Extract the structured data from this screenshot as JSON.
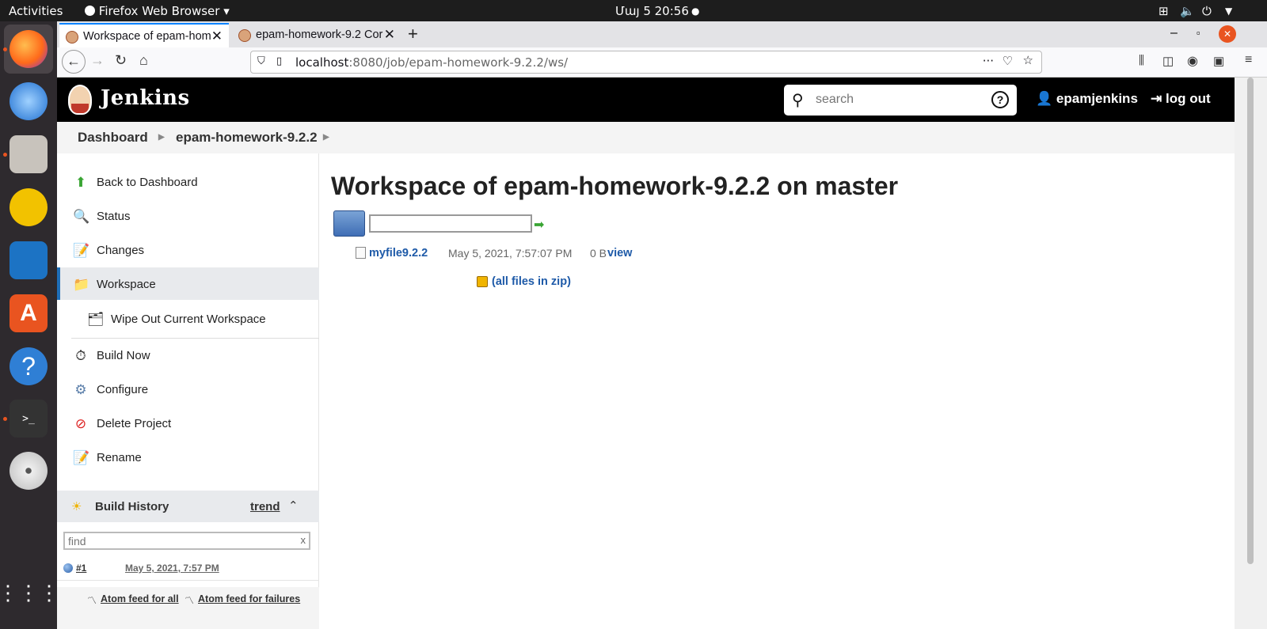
{
  "os": {
    "activities": "Activities",
    "app_menu": "Firefox Web Browser",
    "clock": "Մայ 5  20:56"
  },
  "browser": {
    "tabs": [
      {
        "label": "Workspace of epam-hom"
      },
      {
        "label": "epam-homework-9.2 Cor"
      }
    ],
    "url_host": "localhost",
    "url_rest": ":8080/job/epam-homework-9.2.2/ws/"
  },
  "jenkins": {
    "title": "Jenkins",
    "search_placeholder": "search",
    "user": "epamjenkins",
    "logout": "log out"
  },
  "breadcrumbs": [
    "Dashboard",
    "epam-homework-9.2.2"
  ],
  "sidebar": {
    "items": [
      {
        "label": "Back to Dashboard",
        "icon": "arrow-up-icon"
      },
      {
        "label": "Status",
        "icon": "magnifier-icon"
      },
      {
        "label": "Changes",
        "icon": "notepad-icon"
      },
      {
        "label": "Workspace",
        "icon": "folder-icon"
      },
      {
        "label": "Wipe Out Current Workspace",
        "icon": "folder-delete-icon"
      },
      {
        "label": "Build Now",
        "icon": "clock-icon"
      },
      {
        "label": "Configure",
        "icon": "gear-icon"
      },
      {
        "label": "Delete Project",
        "icon": "no-entry-icon"
      },
      {
        "label": "Rename",
        "icon": "notepad-icon"
      }
    ],
    "build_history": {
      "title": "Build History",
      "trend": "trend",
      "find_placeholder": "find",
      "clear": "x",
      "builds": [
        {
          "number": "#1",
          "date": "May 5, 2021, 7:57 PM"
        }
      ],
      "feed_all": "Atom feed for all",
      "feed_failures": "Atom feed for failures"
    }
  },
  "workspace": {
    "title": "Workspace of epam-homework-9.2.2 on master",
    "files": [
      {
        "name": "myfile9.2.2",
        "date": "May 5, 2021, 7:57:07 PM",
        "size": "0 B",
        "action": "view"
      }
    ],
    "zip": "(all files in zip)"
  }
}
